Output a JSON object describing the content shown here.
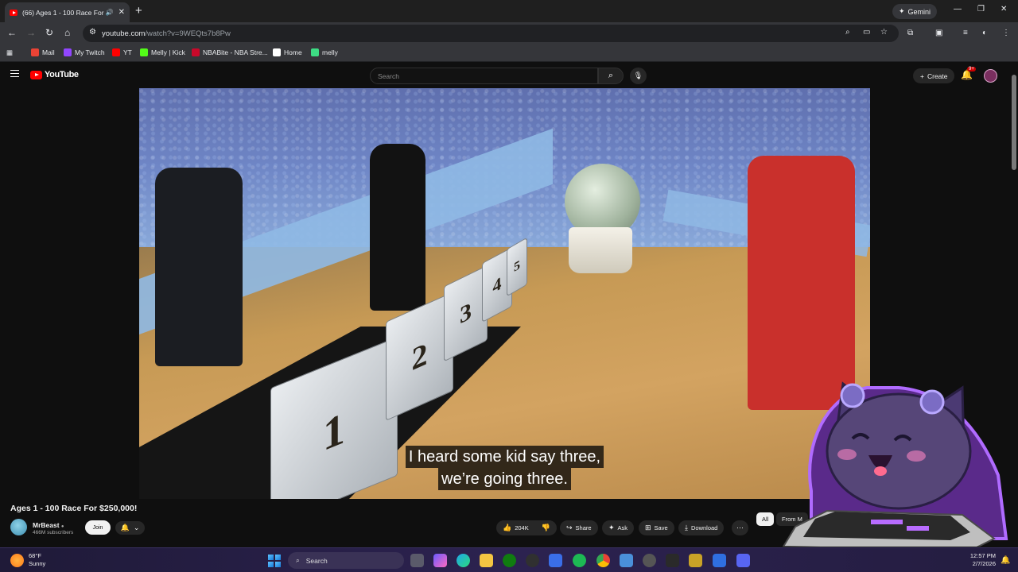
{
  "browser": {
    "tab_title": "(66) Ages 1 - 100 Race For",
    "tab_sound_icon": "speaker-icon",
    "new_tab_label": "+",
    "gemini_label": "Gemini",
    "url_host": "youtube.com",
    "url_path": "/watch?v=9WEQts7b8Pw",
    "bookmarks": [
      {
        "label": "Mail",
        "icon": "gmail-icon",
        "color": "#ea4335"
      },
      {
        "label": "My Twitch",
        "icon": "twitch-icon",
        "color": "#9146ff"
      },
      {
        "label": "YT",
        "icon": "youtube-icon",
        "color": "#ff0000"
      },
      {
        "label": "Melly | Kick",
        "icon": "kick-icon",
        "color": "#53fc18"
      },
      {
        "label": "NBABite - NBA Stre...",
        "icon": "nba-icon",
        "color": "#c9082a"
      },
      {
        "label": "Home",
        "icon": "x-icon",
        "color": "#ffffff"
      },
      {
        "label": "melly",
        "icon": "leaf-icon",
        "color": "#3ddc84"
      }
    ]
  },
  "youtube": {
    "logo_text": "YouTube",
    "search_placeholder": "Search",
    "create_label": "Create",
    "notif_badge": "9+"
  },
  "video": {
    "caption_line1": "I heard some kid say three,",
    "caption_line2": "we’re going three.",
    "case_numbers": [
      "1",
      "2",
      "3",
      "4",
      "5"
    ],
    "title": "Ages 1 - 100 Race For $250,000!",
    "channel_name": "MrBeast",
    "verified_icon": "verified-check-icon",
    "subscribers": "466M subscribers",
    "join_label": "Join",
    "likes": "204K",
    "share_label": "Share",
    "ask_label": "Ask",
    "save_label": "Save",
    "download_label": "Download",
    "chip_all": "All",
    "chip_from": "From M"
  },
  "taskbar": {
    "temp": "68°F",
    "condition": "Sunny",
    "search_label": "Search",
    "time": "12:57 PM",
    "date": "2/7/2026",
    "accent": "#2c2250"
  }
}
